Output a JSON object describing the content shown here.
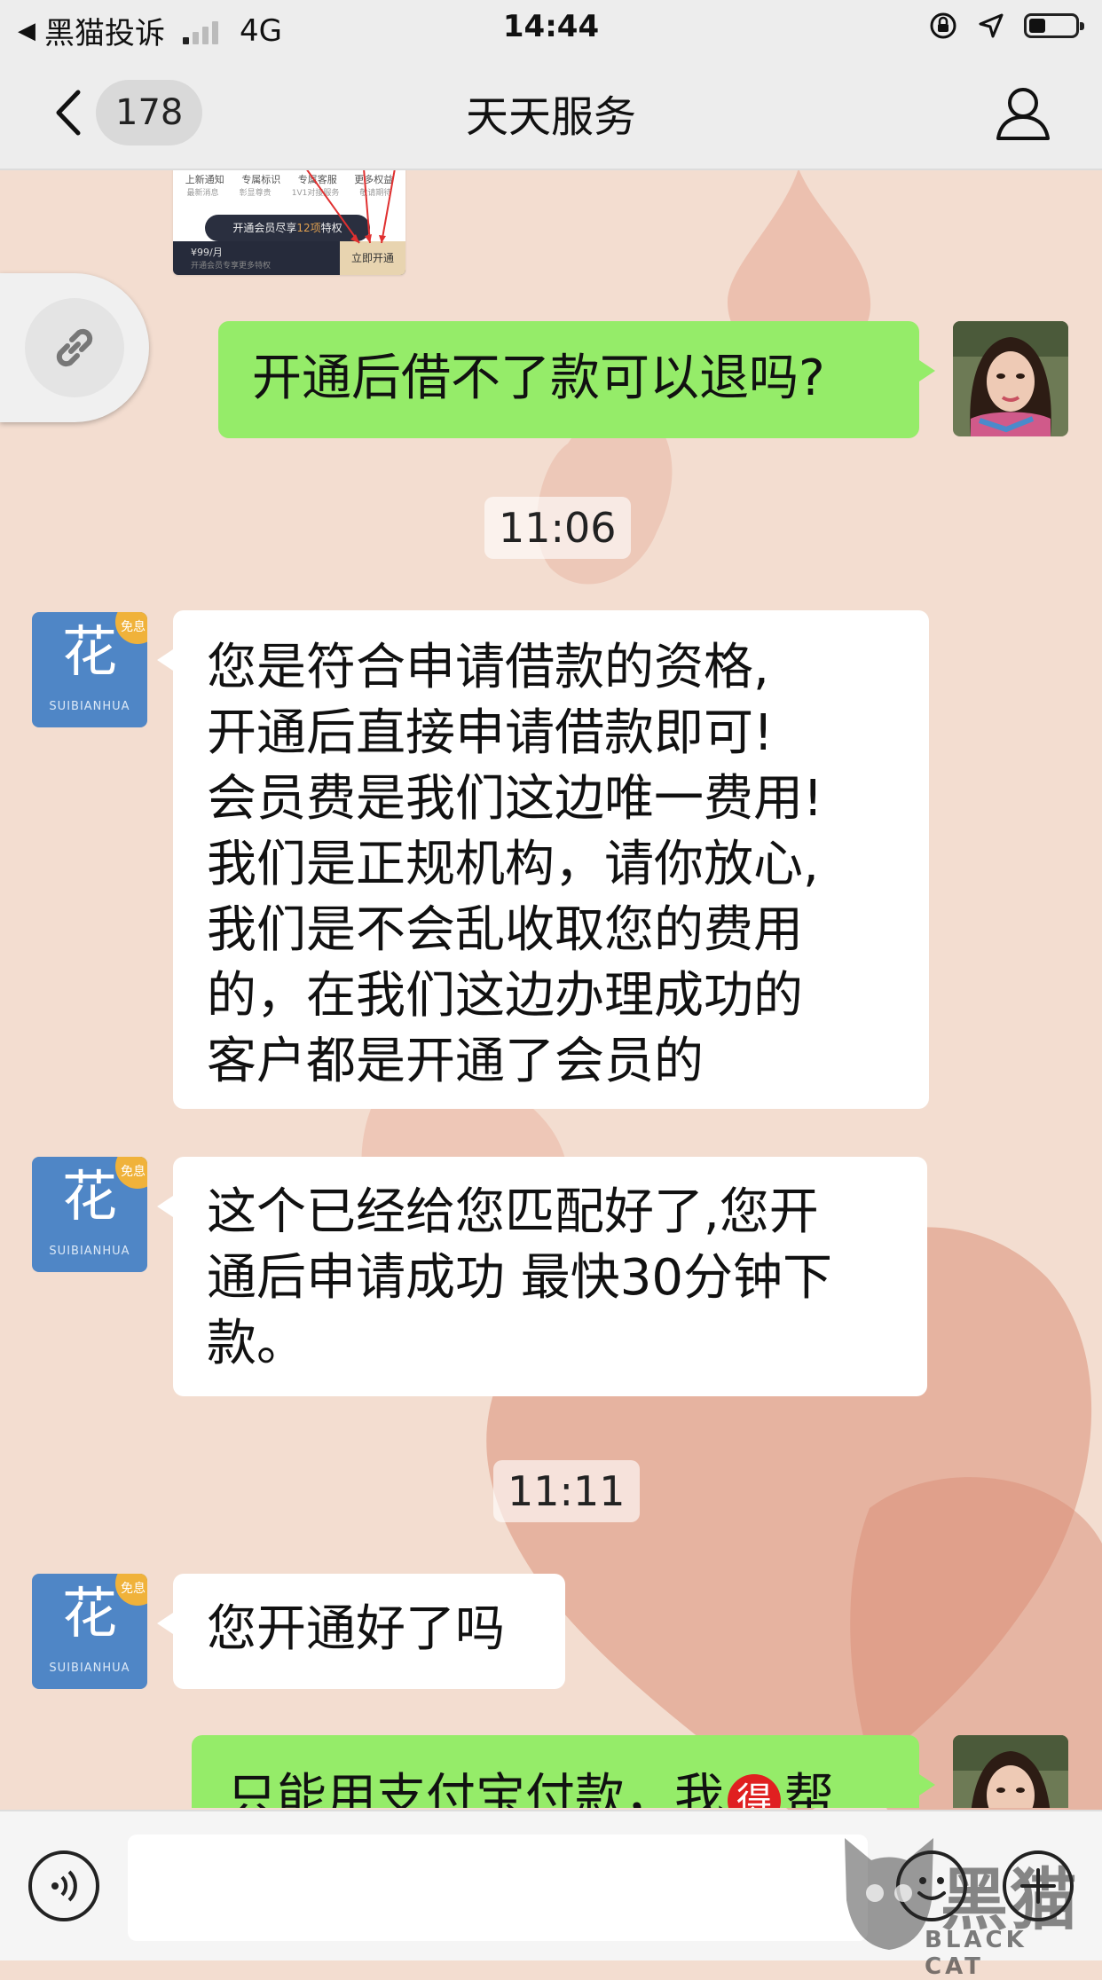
{
  "status_bar": {
    "carrier": "黑猫投诉",
    "network": "4G",
    "time": "14:44",
    "battery_level": 0.35
  },
  "nav": {
    "unread_count": "178",
    "title": "天天服务",
    "back_icon": "chevron-left-icon",
    "profile_icon": "person-icon"
  },
  "preview_card": {
    "features": [
      "上新通知",
      "专属标识",
      "专属客服",
      "更多权益"
    ],
    "feature_subs": [
      "最新消息",
      "彰显尊贵",
      "1V1对接服务",
      "敬请期待"
    ],
    "cta_prefix": "开通会员尽享",
    "cta_highlight": "12项",
    "cta_suffix": "特权",
    "price": "¥99/月",
    "price_sub": "开通会员专享更多特权",
    "open_label": "立即开通"
  },
  "messages": [
    {
      "from": "me",
      "text": "开通后借不了款可以退吗?"
    },
    {
      "type": "time",
      "text": "11:06"
    },
    {
      "from": "agent",
      "lines": [
        "您是符合申请借款的资格,",
        "开通后直接申请借款即可!",
        "会员费是我们这边唯一费用!",
        "我们是正规机构，请你放心,",
        "我们是不会乱收取您的费用",
        "的，在我们这边办理成功的",
        "客户都是开通了会员的"
      ]
    },
    {
      "from": "agent",
      "lines": [
        "这个已经给您匹配好了,您开",
        "通后申请成功 最快30分钟下",
        "款。"
      ]
    },
    {
      "type": "time",
      "text": "11:11"
    },
    {
      "from": "agent",
      "text": "您开通好了吗"
    },
    {
      "from": "me",
      "text_a": "只能用支付宝付款，我",
      "badge": "得",
      "text_b": "帮"
    }
  ],
  "agent_avatar": {
    "char": "花",
    "brand": "SUIBIANHUA",
    "tag": "免息"
  },
  "watermark": {
    "text": "黑猫",
    "sub": "BLACK CAT"
  },
  "colors": {
    "me_bubble": "#95ec69",
    "agent_avatar": "#4f86c6",
    "badge": "#e02020"
  }
}
